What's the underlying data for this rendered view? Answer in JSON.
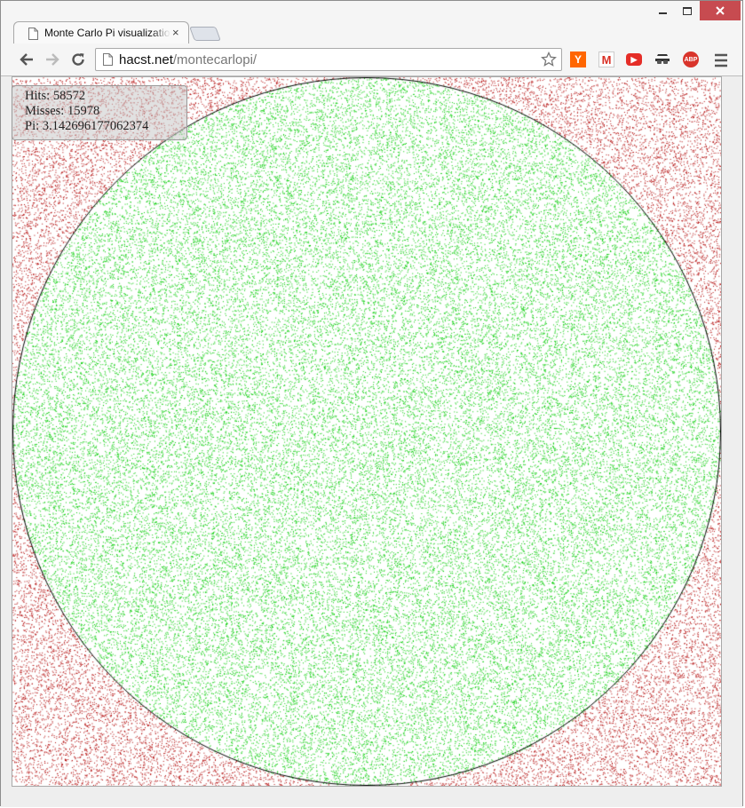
{
  "browser": {
    "tab_title": "Monte Carlo Pi visualizatio",
    "tab_close": "×",
    "url_host": "hacst.net",
    "url_path": "/montecarlopi/"
  },
  "extensions": [
    {
      "name": "y-combinator-icon",
      "label": "Y",
      "color": "#ff6600"
    },
    {
      "name": "gmail-icon",
      "label": "M",
      "color": "#d93025"
    },
    {
      "name": "youtube-icon",
      "label": "▶",
      "color": "#e52d27"
    },
    {
      "name": "incognito-mask-icon",
      "label": "",
      "color": "#333333"
    },
    {
      "name": "adblock-plus-icon",
      "label": "ABP",
      "color": "#d9342b"
    }
  ],
  "stats": {
    "hits_label": "Hits:",
    "hits": 58572,
    "misses_label": "Misses:",
    "misses": 15978,
    "pi_label": "Pi:",
    "pi": "3.142696177062374"
  },
  "colors": {
    "hit_point": "#00cc00",
    "miss_point": "#b00000",
    "circle_stroke": "#000000"
  }
}
